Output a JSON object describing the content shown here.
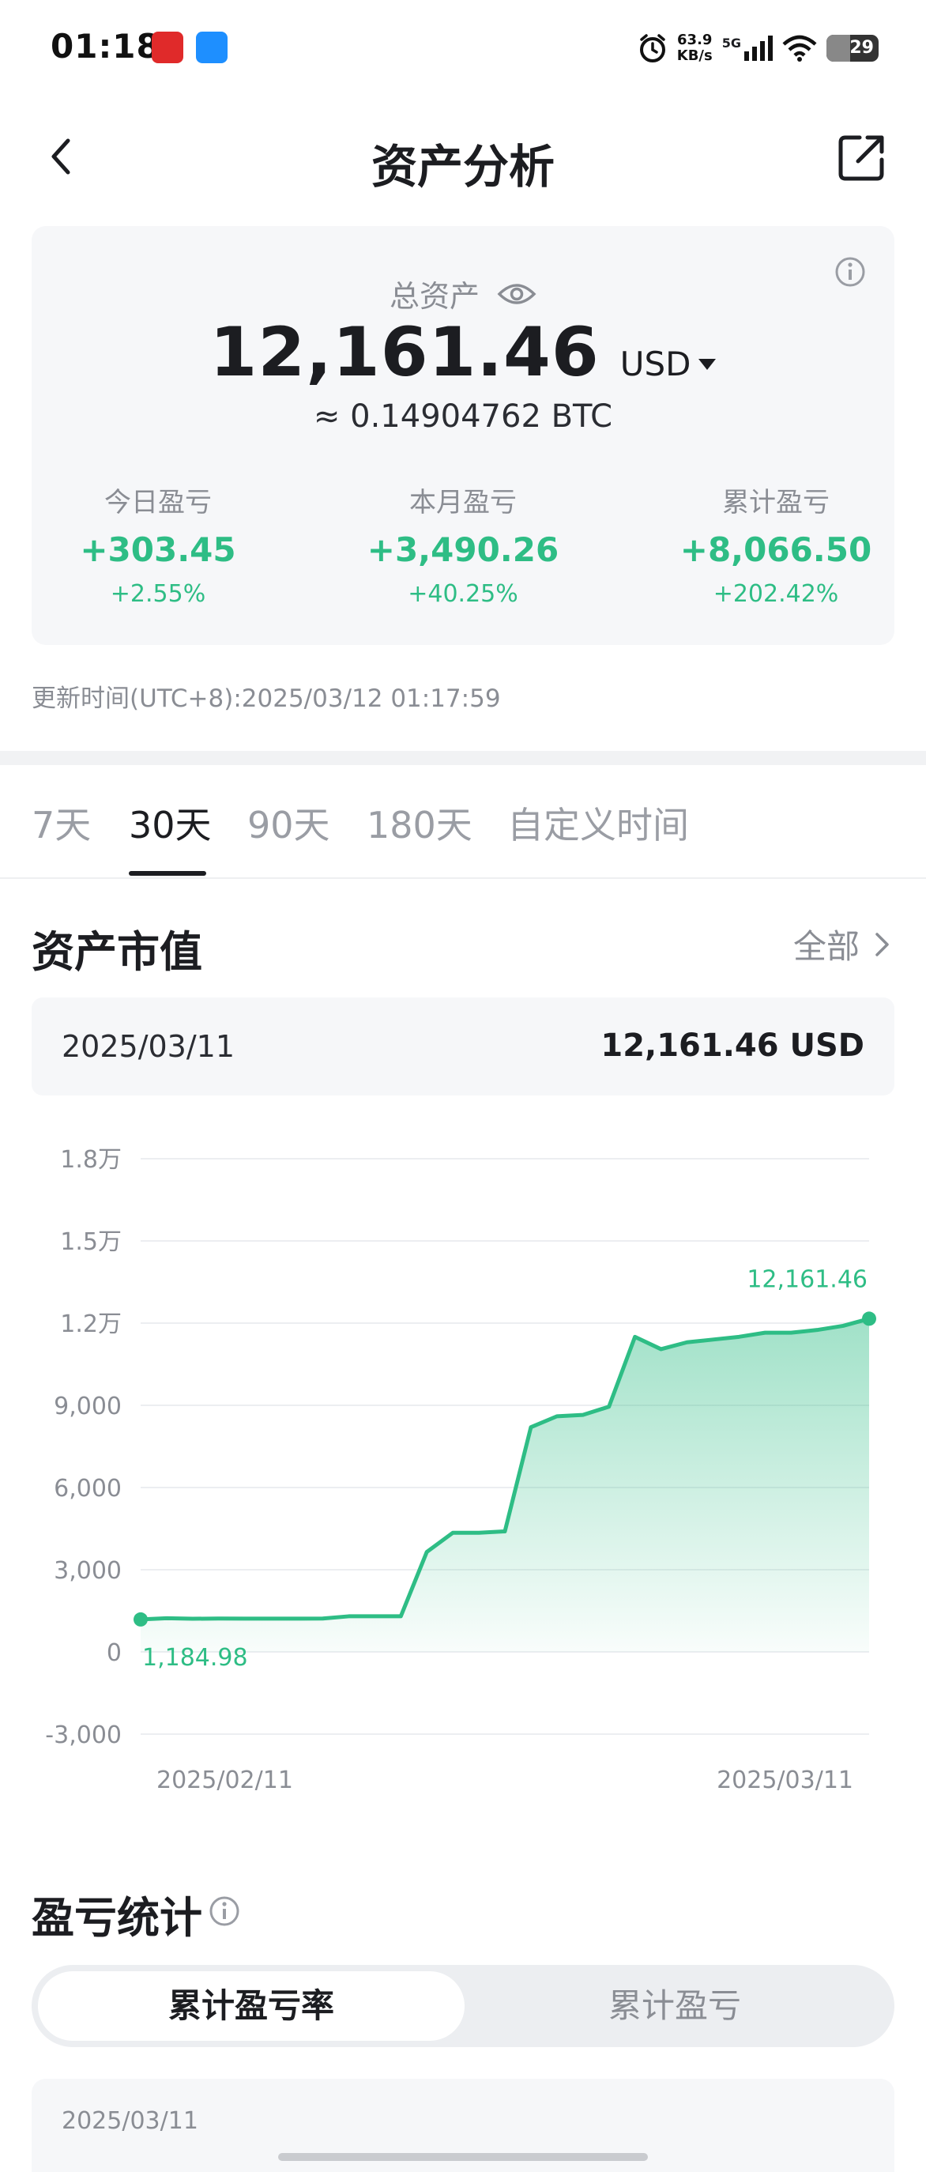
{
  "status_bar": {
    "time": "01:18",
    "net_speed_value": "63.9",
    "net_speed_unit": "KB/s",
    "network": "5G",
    "battery": "29"
  },
  "header": {
    "title": "资产分析"
  },
  "summary": {
    "total_label": "总资产",
    "total_value": "12,161.46",
    "currency": "USD",
    "btc_equivalent": "≈ 0.14904762 BTC",
    "today": {
      "label": "今日盈亏",
      "value": "+303.45",
      "pct": "+2.55%"
    },
    "month": {
      "label": "本月盈亏",
      "value": "+3,490.26",
      "pct": "+40.25%"
    },
    "cumulative": {
      "label": "累计盈亏",
      "value": "+8,066.50",
      "pct": "+202.42%"
    },
    "update_time": "更新时间(UTC+8):2025/03/12 01:17:59"
  },
  "tabs": [
    {
      "label": "7天",
      "active": false
    },
    {
      "label": "30天",
      "active": true
    },
    {
      "label": "90天",
      "active": false
    },
    {
      "label": "180天",
      "active": false
    },
    {
      "label": "自定义时间",
      "active": false
    }
  ],
  "asset_value": {
    "title": "资产市值",
    "all_link": "全部",
    "selected_date": "2025/03/11",
    "selected_value": "12,161.46 USD"
  },
  "chart_data": {
    "type": "area",
    "y_tick_labels": [
      "1.8万",
      "1.5万",
      "1.2万",
      "9,000",
      "6,000",
      "3,000",
      "0",
      "-3,000"
    ],
    "y_ticks": [
      18000,
      15000,
      12000,
      9000,
      6000,
      3000,
      0,
      -3000
    ],
    "ylim": [
      -3000,
      18000
    ],
    "x_tick_labels": [
      "2025/02/11",
      "2025/03/11"
    ],
    "x": [
      "2025/02/11",
      "2025/02/12",
      "2025/02/13",
      "2025/02/14",
      "2025/02/15",
      "2025/02/16",
      "2025/02/17",
      "2025/02/18",
      "2025/02/19",
      "2025/02/20",
      "2025/02/21",
      "2025/02/22",
      "2025/02/23",
      "2025/02/24",
      "2025/02/25",
      "2025/02/26",
      "2025/02/27",
      "2025/02/28",
      "2025/03/01",
      "2025/03/02",
      "2025/03/03",
      "2025/03/04",
      "2025/03/05",
      "2025/03/06",
      "2025/03/07",
      "2025/03/08",
      "2025/03/09",
      "2025/03/10",
      "2025/03/11"
    ],
    "values": [
      1184.98,
      1230,
      1210,
      1220,
      1215,
      1215,
      1215,
      1220,
      1300,
      1300,
      1300,
      3650,
      4350,
      4350,
      4400,
      8200,
      8600,
      8650,
      8950,
      11500,
      11050,
      11300,
      11400,
      11500,
      11650,
      11650,
      11750,
      11900,
      12161.46
    ],
    "point_labels": {
      "first": "1,184.98",
      "last": "12,161.46"
    },
    "grid": true,
    "line_color": "#2ebd85"
  },
  "pnl_stats": {
    "title": "盈亏统计",
    "options": [
      "累计盈亏率",
      "累计盈亏"
    ],
    "active_option": 0,
    "card_date": "2025/03/11"
  },
  "colors": {
    "positive": "#2ebd85",
    "card_bg": "#f6f7f9",
    "text_primary": "#1c1d21",
    "text_secondary": "#8a8d94"
  }
}
